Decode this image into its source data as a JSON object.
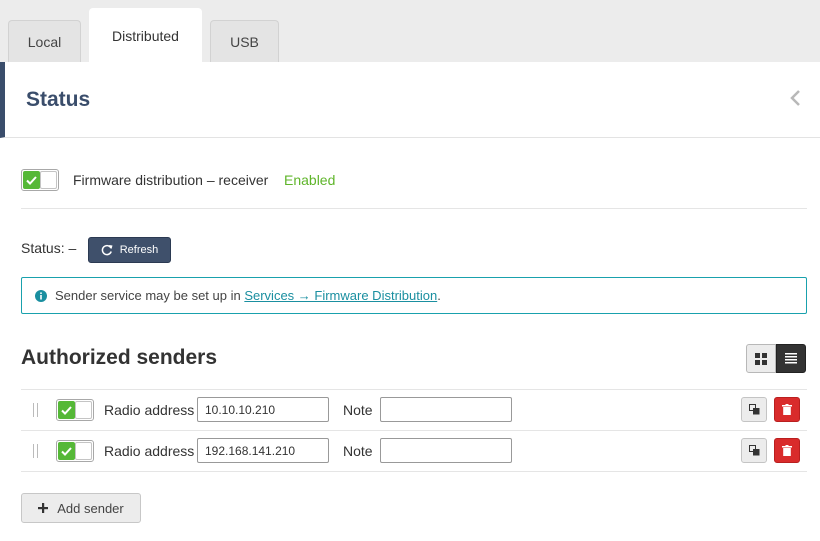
{
  "tabs": {
    "local": "Local",
    "distributed": "Distributed",
    "usb": "USB"
  },
  "status_section": {
    "title": "Status",
    "receiver_toggle_label": "Firmware distribution – receiver",
    "receiver_state": "Enabled",
    "status_text": "Status: –",
    "refresh_label": "Refresh"
  },
  "info": {
    "text": "Sender service may be set up in ",
    "link": "Services → Firmware Distribution",
    "suffix": "."
  },
  "senders": {
    "title": "Authorized senders",
    "radio_label": "Radio address",
    "note_label": "Note",
    "items": [
      {
        "address": "10.10.10.210",
        "note": ""
      },
      {
        "address": "192.168.141.210",
        "note": ""
      }
    ],
    "add_label": "Add sender"
  },
  "colors": {
    "accent": "#3a4d6b",
    "enabled": "#5fb52a",
    "toggle_on": "#55b837",
    "info_border": "#19a1ad",
    "danger": "#d92b2b"
  },
  "icons": {
    "collapse": "chevron-left-icon",
    "refresh": "refresh-icon",
    "info": "info-icon",
    "grid": "grid-icon",
    "list": "list-icon",
    "copy": "copy-icon",
    "delete": "trash-icon",
    "add": "plus-icon"
  }
}
